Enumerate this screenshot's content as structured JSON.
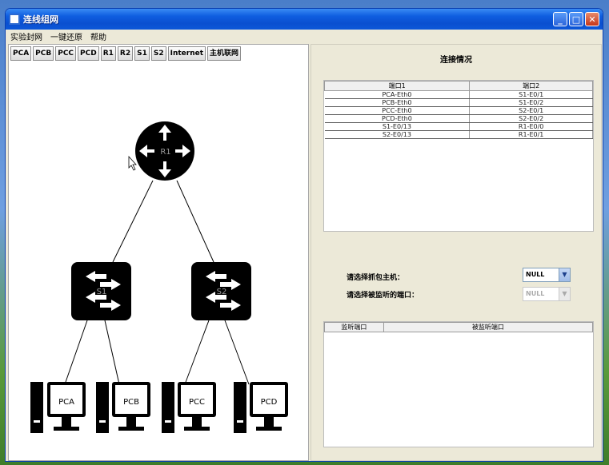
{
  "window": {
    "title": "连线组网"
  },
  "menu": {
    "items": [
      "实验封网",
      "一键还原",
      "帮助"
    ]
  },
  "tabs": [
    "PCA",
    "PCB",
    "PCC",
    "PCD",
    "R1",
    "R2",
    "S1",
    "S2",
    "Internet",
    "主机联网"
  ],
  "topology": {
    "router": "R1",
    "switches": [
      "S1",
      "S2"
    ],
    "pcs": [
      "PCA",
      "PCB",
      "PCC",
      "PCD"
    ]
  },
  "connections": {
    "title": "连接情况",
    "columns": [
      "端口1",
      "端口2"
    ],
    "rows": [
      [
        "PCA-Eth0",
        "S1-E0/1"
      ],
      [
        "PCB-Eth0",
        "S1-E0/2"
      ],
      [
        "PCC-Eth0",
        "S2-E0/1"
      ],
      [
        "PCD-Eth0",
        "S2-E0/2"
      ],
      [
        "S1-E0/13",
        "R1-E0/0"
      ],
      [
        "S2-E0/13",
        "R1-E0/1"
      ]
    ]
  },
  "capture": {
    "host_label": "请选择抓包主机：",
    "host_value": "NULL",
    "port_label": "请选择被监听的端口：",
    "port_value": "NULL"
  },
  "monitor": {
    "columns": [
      "监听端口",
      "被监听端口"
    ]
  }
}
